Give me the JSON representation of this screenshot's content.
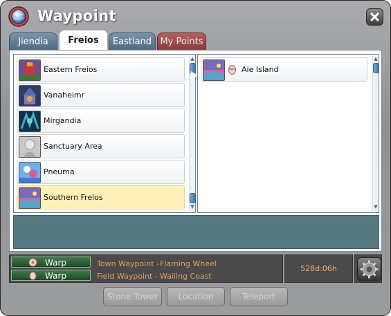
{
  "window": {
    "title": "Waypoint"
  },
  "tabs": [
    {
      "label": "Jiendia"
    },
    {
      "label": "Freios"
    },
    {
      "label": "Eastland"
    },
    {
      "label": "My Points"
    }
  ],
  "regions": [
    {
      "label": "Eastern Freios",
      "thumb": "eastern-freios-thumbnail",
      "selected": false
    },
    {
      "label": "Vanaheimr",
      "thumb": "vanaheimr-thumbnail",
      "selected": false
    },
    {
      "label": "Mirgandia",
      "thumb": "mirgandia-thumbnail",
      "selected": false
    },
    {
      "label": "Sanctuary Area",
      "thumb": "sanctuary-area-thumbnail",
      "selected": false
    },
    {
      "label": "Pneuma",
      "thumb": "pneuma-thumbnail",
      "selected": false
    },
    {
      "label": "Southern Freios",
      "thumb": "southern-freios-thumbnail",
      "selected": true
    }
  ],
  "destinations": [
    {
      "label": "Aie Island",
      "icon": "egg-icon"
    }
  ],
  "waypoints": {
    "town": {
      "warp_label": "Warp",
      "label": "Town Waypoint -",
      "value": "Flaming Wheel"
    },
    "field": {
      "warp_label": "Warp",
      "label": "Field Waypoint -",
      "value": "Wailing Coast"
    }
  },
  "timer": "528d:06h",
  "buttons": {
    "stone_tower": "Stone Tower",
    "location": "Location",
    "teleport": "Teleport"
  },
  "colors": {
    "selected_row": "#fdf0b8",
    "description_panel": "#577a80",
    "waypoint_text": "#e0a060",
    "timer_text": "#f0b070",
    "active_tab_mypoints": "#9a4746"
  }
}
